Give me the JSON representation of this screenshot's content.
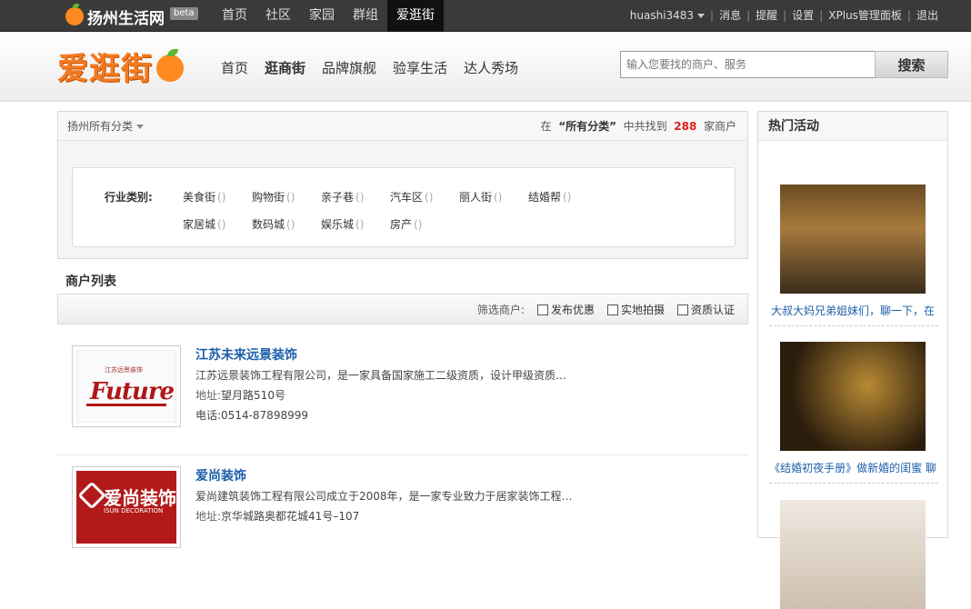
{
  "topbar": {
    "site_name": "扬州生活网",
    "beta": "beta",
    "nav": [
      "首页",
      "社区",
      "家园",
      "群组",
      "爱逛街"
    ],
    "active_nav": "爱逛街",
    "username": "huashi3483",
    "links": [
      "消息",
      "提醒",
      "设置",
      "XPlus管理面板",
      "退出"
    ]
  },
  "header": {
    "brand": "爱逛街",
    "nav": [
      "首页",
      "逛商街",
      "品牌旗舰",
      "验享生活",
      "达人秀场"
    ],
    "active_nav": "逛商街",
    "search_placeholder": "输入您要找的商户、服务",
    "search_button": "搜索"
  },
  "filter": {
    "region": "扬州所有分类",
    "stat_prefix": "在",
    "stat_scope": "“所有分类”",
    "stat_middle": "中共找到",
    "stat_count": "288",
    "stat_suffix": "家商户",
    "category_label": "行业类别:",
    "categories": [
      {
        "name": "美食街",
        "count": "()"
      },
      {
        "name": "购物街",
        "count": "()"
      },
      {
        "name": "亲子巷",
        "count": "()"
      },
      {
        "name": "汽车区",
        "count": "()"
      },
      {
        "name": "丽人街",
        "count": "()"
      },
      {
        "name": "结婚帮",
        "count": "()"
      },
      {
        "name": "家居城",
        "count": "()"
      },
      {
        "name": "数码城",
        "count": "()"
      },
      {
        "name": "娱乐城",
        "count": "()"
      },
      {
        "name": "房产",
        "count": "()"
      }
    ]
  },
  "list": {
    "title": "商户列表",
    "filter_label": "筛选商户:",
    "options": [
      "发布优惠",
      "实地拍摄",
      "资质认证"
    ],
    "merchants": [
      {
        "name": "江苏未来远景装饰",
        "desc": "江苏远景装饰工程有限公司，是一家具备国家施工二级资质，设计甲级资质…",
        "addr_label": "地址:",
        "addr": "望月路510号",
        "phone_label": "电话:",
        "phone": "0514-87898999",
        "logo_top": "江苏远景装饰",
        "logo_word": "Future"
      },
      {
        "name": "爱尚装饰",
        "desc": "爱尚建筑装饰工程有限公司成立于2008年，是一家专业致力于居家装饰工程…",
        "addr_label": "地址:",
        "addr": "京华城路奥都花城41号–107",
        "logo_cn": "爱尚装饰",
        "logo_en": "ISUN DECORATION"
      }
    ]
  },
  "sidebar": {
    "title": "热门活动",
    "activities": [
      {
        "caption": "大叔大妈兄弟姐妹们，聊一下，在"
      },
      {
        "caption": "《结婚初夜手册》做新婚的闺蜜 聊"
      },
      {
        "caption": ""
      }
    ]
  }
}
